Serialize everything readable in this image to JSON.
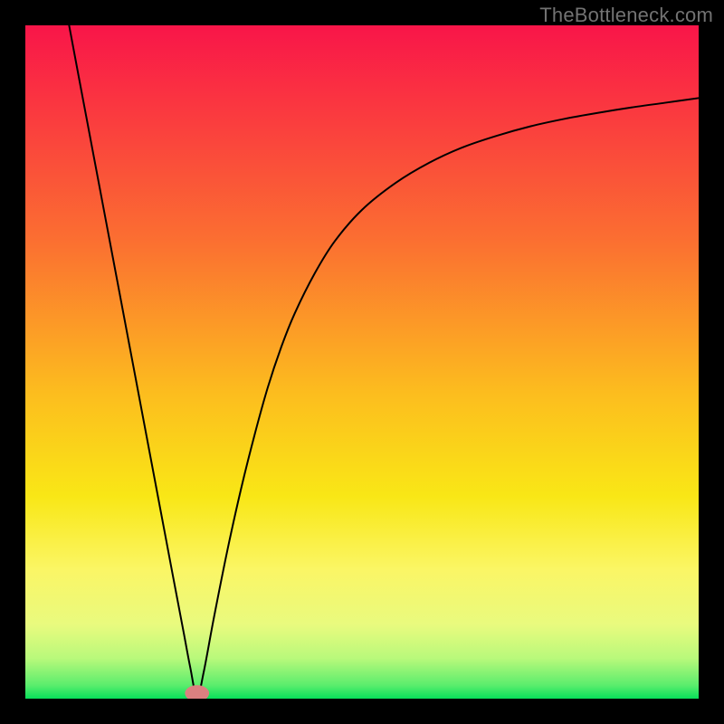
{
  "watermark": "TheBottleneck.com",
  "chart_data": {
    "type": "line",
    "title": "",
    "xlabel": "",
    "ylabel": "",
    "xlim": [
      0,
      100
    ],
    "ylim": [
      0,
      100
    ],
    "grid": false,
    "legend": false,
    "gradient_stops": [
      {
        "offset": 0,
        "color": "#f91549"
      },
      {
        "offset": 32,
        "color": "#fb6f31"
      },
      {
        "offset": 55,
        "color": "#fcbe1e"
      },
      {
        "offset": 70,
        "color": "#f9e716"
      },
      {
        "offset": 81,
        "color": "#faf666"
      },
      {
        "offset": 89,
        "color": "#e9fa7e"
      },
      {
        "offset": 94,
        "color": "#b9f97b"
      },
      {
        "offset": 98,
        "color": "#5bed6d"
      },
      {
        "offset": 100,
        "color": "#08e05a"
      }
    ],
    "marker": {
      "x": 25.5,
      "y": 0.8,
      "rx": 1.8,
      "ry": 1.2,
      "color": "#db8080"
    },
    "series": [
      {
        "name": "curve",
        "color": "#000000",
        "points": [
          {
            "x": 6.5,
            "y": 100.0
          },
          {
            "x": 8.0,
            "y": 92.0
          },
          {
            "x": 10.0,
            "y": 81.4
          },
          {
            "x": 12.0,
            "y": 70.8
          },
          {
            "x": 14.0,
            "y": 60.2
          },
          {
            "x": 16.0,
            "y": 49.6
          },
          {
            "x": 18.0,
            "y": 39.0
          },
          {
            "x": 20.0,
            "y": 28.4
          },
          {
            "x": 22.0,
            "y": 17.8
          },
          {
            "x": 23.5,
            "y": 9.9
          },
          {
            "x": 24.5,
            "y": 4.6
          },
          {
            "x": 25.5,
            "y": 0.2
          },
          {
            "x": 26.5,
            "y": 4.0
          },
          {
            "x": 28.0,
            "y": 12.0
          },
          {
            "x": 30.0,
            "y": 22.0
          },
          {
            "x": 32.0,
            "y": 31.0
          },
          {
            "x": 34.0,
            "y": 39.0
          },
          {
            "x": 36.0,
            "y": 46.2
          },
          {
            "x": 38.0,
            "y": 52.2
          },
          {
            "x": 40.0,
            "y": 57.2
          },
          {
            "x": 43.0,
            "y": 63.2
          },
          {
            "x": 46.0,
            "y": 68.0
          },
          {
            "x": 50.0,
            "y": 72.6
          },
          {
            "x": 55.0,
            "y": 76.6
          },
          {
            "x": 60.0,
            "y": 79.6
          },
          {
            "x": 65.0,
            "y": 81.9
          },
          {
            "x": 70.0,
            "y": 83.6
          },
          {
            "x": 75.0,
            "y": 85.0
          },
          {
            "x": 80.0,
            "y": 86.1
          },
          {
            "x": 85.0,
            "y": 87.0
          },
          {
            "x": 90.0,
            "y": 87.8
          },
          {
            "x": 95.0,
            "y": 88.5
          },
          {
            "x": 100.0,
            "y": 89.2
          }
        ]
      }
    ]
  }
}
